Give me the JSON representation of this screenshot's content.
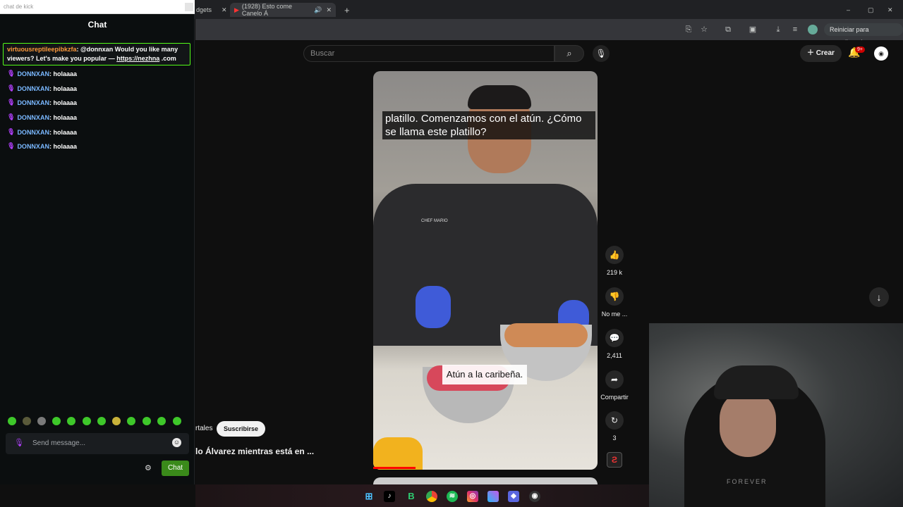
{
  "browser": {
    "tab_partial_left": "dgets",
    "active_tab_title": "(1928) Esto come Canelo Á",
    "restart_label": "Reiniciar para actualizar"
  },
  "youtube": {
    "search_placeholder": "Buscar",
    "create_label": "Crear",
    "notification_badge": "9+",
    "video": {
      "caption_top": "platillo. Comenzamos con el atún. ¿Cómo se llama este platillo?",
      "caption_mid": "Atún a la caribeña.",
      "chef_name": "CHEF MARIO"
    },
    "actions": {
      "likes": "219 k",
      "dislike_label": "No me ...",
      "comments": "2,411",
      "share_label": "Compartir",
      "remix_count": "3"
    },
    "channel_partial": "rtales",
    "subscribe_label": "Suscribirse",
    "title_partial": "lo Álvarez mientras está en ..."
  },
  "webcam": {
    "shirt_text": "FOREVER"
  },
  "chat": {
    "topbar_title": "chat de kick",
    "title": "Chat",
    "pinned": {
      "user": "virtuousreptileepibkzfa",
      "text": ": @donnxan Would you like many viewers? Let's make you popular — ",
      "link": "https://nezhna",
      "suffix": " .com"
    },
    "messages": [
      {
        "user": "DONNXAN",
        "text": ": holaaaa"
      },
      {
        "user": "DONNXAN",
        "text": ": holaaaa"
      },
      {
        "user": "DONNXAN",
        "text": ": holaaaa"
      },
      {
        "user": "DONNXAN",
        "text": ": holaaaa"
      },
      {
        "user": "DONNXAN",
        "text": ": holaaaa"
      },
      {
        "user": "DONNXAN",
        "text": ": holaaaa"
      }
    ],
    "input_placeholder": "Send message...",
    "send_label": "Chat"
  },
  "taskbar": {
    "icons": [
      "windows-icon",
      "tiktok-icon",
      "b-app-icon",
      "chrome-icon",
      "spotify-icon",
      "instagram-icon",
      "copilot-icon",
      "app-icon",
      "obs-icon"
    ]
  }
}
